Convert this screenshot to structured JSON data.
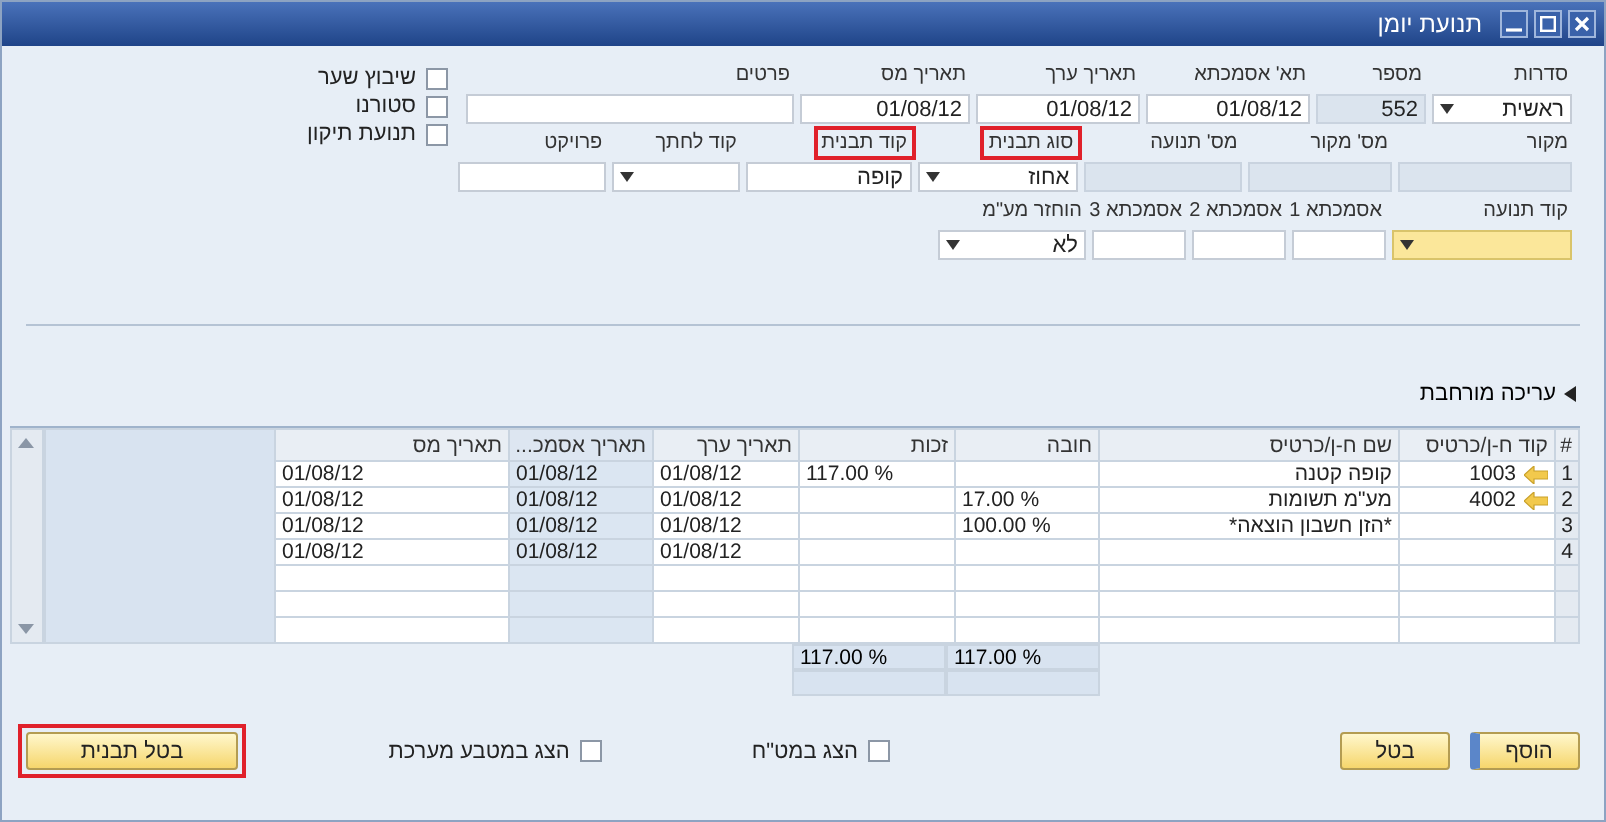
{
  "window": {
    "title": "תנועת יומן"
  },
  "field_rows": [
    {
      "fields": [
        {
          "label": "סדרות",
          "value": "ראשית",
          "kind": "dropdown",
          "focused": false,
          "highlighted": false
        },
        {
          "label": "מספר",
          "value": "552",
          "kind": "display",
          "focused": false,
          "highlighted": false
        },
        {
          "label": "תא' אסמכתא",
          "value": "01/08/12",
          "kind": "text",
          "focused": false,
          "highlighted": false
        },
        {
          "label": "תאריך ערך",
          "value": "01/08/12",
          "kind": "text",
          "focused": false,
          "highlighted": false
        },
        {
          "label": "תאריך מס",
          "value": "01/08/12",
          "kind": "text",
          "focused": false,
          "highlighted": false
        },
        {
          "label": "פרטים",
          "kind": "text",
          "focused": false,
          "highlighted": false
        }
      ]
    },
    {
      "fields": [
        {
          "label": "מקור",
          "kind": "display",
          "focused": false,
          "highlighted": false
        },
        {
          "label": "מס' מקור",
          "kind": "display",
          "focused": false,
          "highlighted": false
        },
        {
          "label": "מס' תנועה",
          "kind": "display",
          "focused": false,
          "highlighted": false
        },
        {
          "label": "סוג תבנית",
          "value": "אחוז",
          "kind": "dropdown",
          "focused": false,
          "highlighted": true
        },
        {
          "label": "קוד תבנית",
          "value": "קופה",
          "kind": "text",
          "focused": false,
          "highlighted": true
        },
        {
          "label": "קוד לחתך",
          "kind": "dropdown",
          "focused": false,
          "highlighted": false
        },
        {
          "label": "פרויקט",
          "kind": "text",
          "focused": false,
          "highlighted": false
        }
      ]
    },
    {
      "fields": [
        {
          "label": "קוד תנועה",
          "kind": "dropdown",
          "focused": true,
          "highlighted": false
        },
        {
          "label": "אסמכתא 1",
          "kind": "text",
          "focused": false,
          "highlighted": false
        },
        {
          "label": "אסמכתא 2",
          "kind": "text",
          "focused": false,
          "highlighted": false
        },
        {
          "label": "אסמכתא 3",
          "kind": "text",
          "focused": false,
          "highlighted": false
        },
        {
          "label": "הוחזר מע\"מ",
          "value": "לא",
          "kind": "dropdown",
          "focused": false,
          "highlighted": false
        }
      ]
    }
  ],
  "checkboxes": [
    {
      "label": "שיבוץ שער",
      "checked": false
    },
    {
      "label": "סטורנו",
      "checked": false
    },
    {
      "label": "תנועת תיקון",
      "checked": false
    }
  ],
  "section_toggle": {
    "label": "עריכה מורחבת",
    "expanded": false
  },
  "table": {
    "columns": [
      {
        "label": "#",
        "shaded": false
      },
      {
        "label": "קוד ח-ן/כרטיס",
        "shaded": false
      },
      {
        "label": "שם ח-ן/כרטיס",
        "shaded": false
      },
      {
        "label": "חובה",
        "shaded": false
      },
      {
        "label": "זכות",
        "shaded": false
      },
      {
        "label": "תאריך ערך",
        "shaded": false
      },
      {
        "label": "תאריך אסמכ...",
        "shaded": true
      },
      {
        "label": "תאריך מס",
        "shaded": false
      }
    ],
    "rows": [
      {
        "link_arrow": true,
        "cells": [
          "1",
          "1003",
          "קופה קטנה",
          null,
          "% 117.00",
          "01/08/12",
          "01/08/12",
          "01/08/12"
        ]
      },
      {
        "link_arrow": true,
        "cells": [
          "2",
          "4002",
          "מע\"מ תשומות",
          "% 17.00",
          null,
          "01/08/12",
          "01/08/12",
          "01/08/12"
        ]
      },
      {
        "link_arrow": false,
        "cells": [
          "3",
          null,
          "*הזן חשבון הוצאה*",
          "% 100.00",
          null,
          "01/08/12",
          "01/08/12",
          "01/08/12"
        ]
      },
      {
        "link_arrow": false,
        "cells": [
          "4",
          null,
          null,
          null,
          null,
          "01/08/12",
          "01/08/12",
          "01/08/12"
        ]
      }
    ],
    "totals": {
      "debit": "% 117.00",
      "credit": "% 117.00"
    }
  },
  "footer": {
    "buttons": [
      {
        "label": "הוסף",
        "default": true
      },
      {
        "label": "בטל",
        "default": false
      }
    ],
    "checkboxes": [
      {
        "label": "הצג במט\"ח",
        "checked": false
      },
      {
        "label": "הצג במטבע מערכת",
        "checked": false
      }
    ],
    "template_button": {
      "label": "בטל תבנית",
      "highlighted": true
    }
  }
}
